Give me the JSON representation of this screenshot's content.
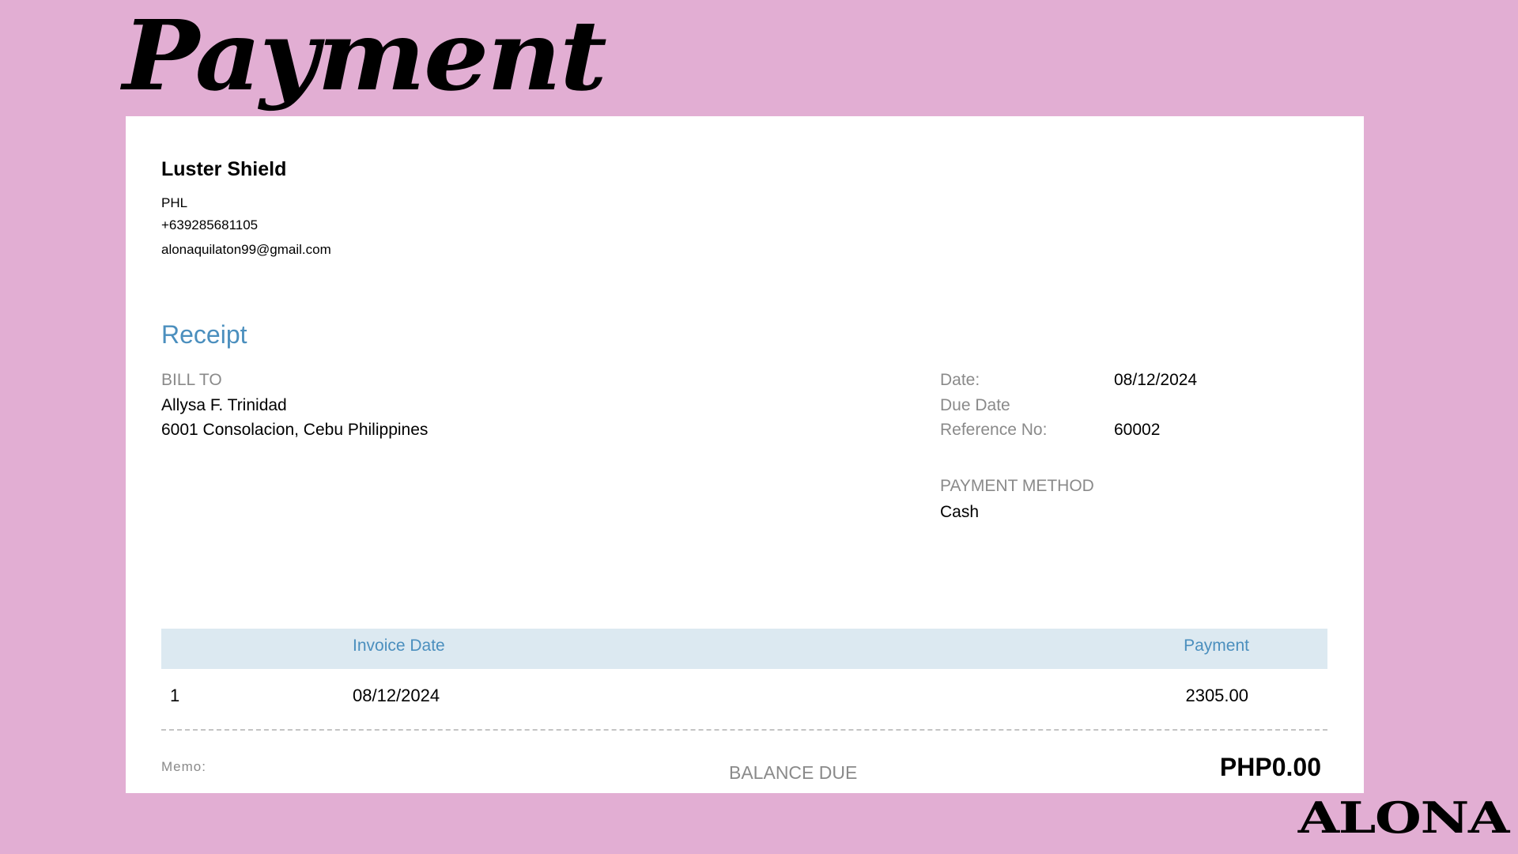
{
  "page": {
    "title": "Payment",
    "background_color": "#e2aed3",
    "brand": "ALONA"
  },
  "company": {
    "name": "Luster Shield",
    "country": "PHL",
    "phone": "+639285681105",
    "email": "alonaquilaton99@gmail.com"
  },
  "document": {
    "title": "Receipt",
    "accent_color": "#4b8fbe"
  },
  "bill_to": {
    "label": "BILL TO",
    "name": "Allysa F. Trinidad",
    "address": "6001 Consolacion, Cebu Philippines"
  },
  "details": {
    "date_label": "Date:",
    "date_value": "08/12/2024",
    "due_date_label": "Due Date",
    "due_date_value": "",
    "reference_label": "Reference No:",
    "reference_value": "60002",
    "payment_method_label": "PAYMENT METHOD",
    "payment_method_value": "Cash"
  },
  "table": {
    "header_color": "#dce9f1",
    "columns": [
      "",
      "Invoice Date",
      "Payment"
    ],
    "rows": [
      {
        "index": "1",
        "invoice_date": "08/12/2024",
        "payment": "2305.00"
      }
    ]
  },
  "footer": {
    "memo_label": "Memo:",
    "balance_label": "BALANCE DUE",
    "balance_value": "PHP0.00"
  }
}
